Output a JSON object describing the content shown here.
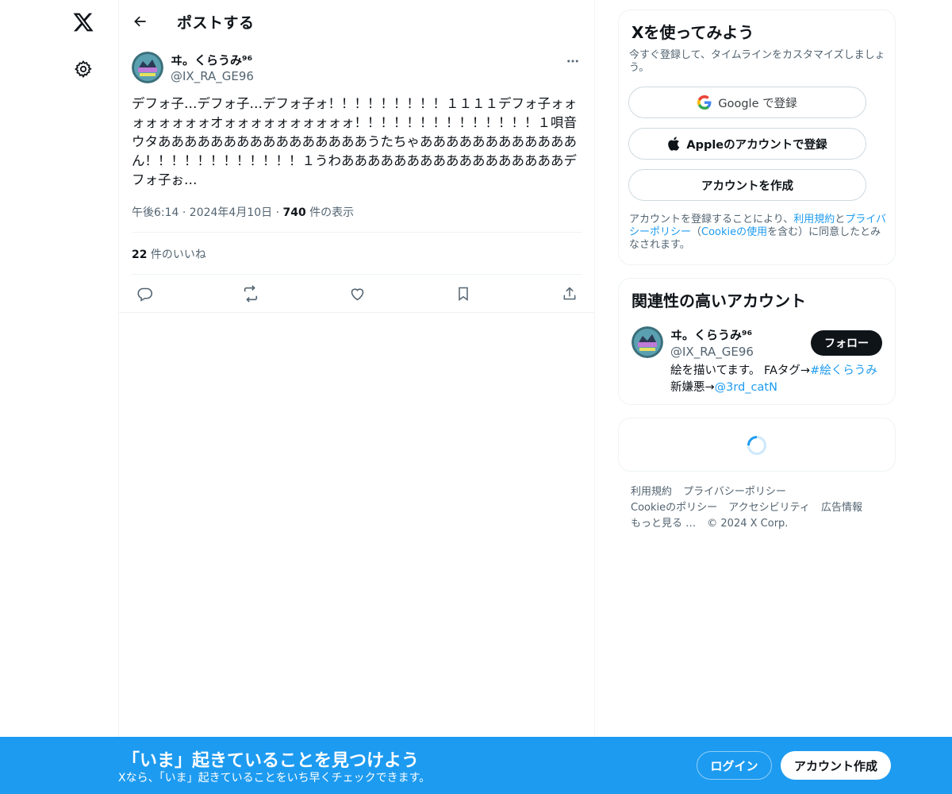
{
  "nav": {
    "logo_icon": "x-logo-icon",
    "settings_icon": "gear-icon"
  },
  "header": {
    "back_icon": "arrow-left-icon",
    "title": "ポストする"
  },
  "post": {
    "author_name": "ヰ。くらうみ⁹⁶",
    "author_handle": "@IX_RA_GE96",
    "text": "デフォ子…デフォ子…デフォ子ォ！！！！！！！！！１１１１デフォ子ォォォォォォォォオォォォォォォォォォォ！！！！！！！！！！！！！！１唄音ウタああああああああああああああああうたちゃああああああああああああん！！！！！！！！！！！！１うわあああああああああああああああああデフォ子ぉ…",
    "timestamp": "午後6:14 · 2024年4月10日",
    "views_count": "740",
    "views_label": " 件の表示",
    "likes_count": "22",
    "likes_label": " 件のいいね",
    "actions": [
      "reply-icon",
      "repost-icon",
      "like-icon",
      "bookmark-icon",
      "share-icon"
    ]
  },
  "signup_card": {
    "title": "Xを使ってみよう",
    "subtitle": "今すぐ登録して、タイムラインをカスタマイズしましょう。",
    "google_label": "Google で登録",
    "apple_label": "Appleのアカウントで登録",
    "create_label": "アカウントを作成",
    "legal_pre": "アカウントを登録することにより、",
    "legal_terms": "利用規約",
    "legal_and": "と",
    "legal_privacy": "プライバシーポリシー",
    "legal_paren_open": "（",
    "legal_cookie": "Cookieの使用",
    "legal_post": "を含む）に同意したとみなされます。"
  },
  "related_card": {
    "title": "関連性の高いアカウント",
    "name": "ヰ。くらうみ⁹⁶",
    "handle": "@IX_RA_GE96",
    "follow_label": "フォロー",
    "bio_line1": "絵を描いてます。 FAタグ→",
    "bio_tag": "#絵くらうみ",
    "bio_line2": "新嫌悪→",
    "bio_mention": "@3rd_catN"
  },
  "footer": {
    "links": [
      "利用規約",
      "プライバシーポリシー",
      "Cookieのポリシー",
      "アクセシビリティ",
      "広告情報",
      "もっと見る …",
      "© 2024 X Corp."
    ]
  },
  "banner": {
    "title": "「いま」起きていることを見つけよう",
    "subtitle": "Xなら、「いま」起きていることをいち早くチェックできます。",
    "login_label": "ログイン",
    "signup_label": "アカウント作成"
  },
  "colors": {
    "accent": "#1d9bf0",
    "text": "#0f1419",
    "muted": "#536471",
    "border": "#eff3f4"
  }
}
